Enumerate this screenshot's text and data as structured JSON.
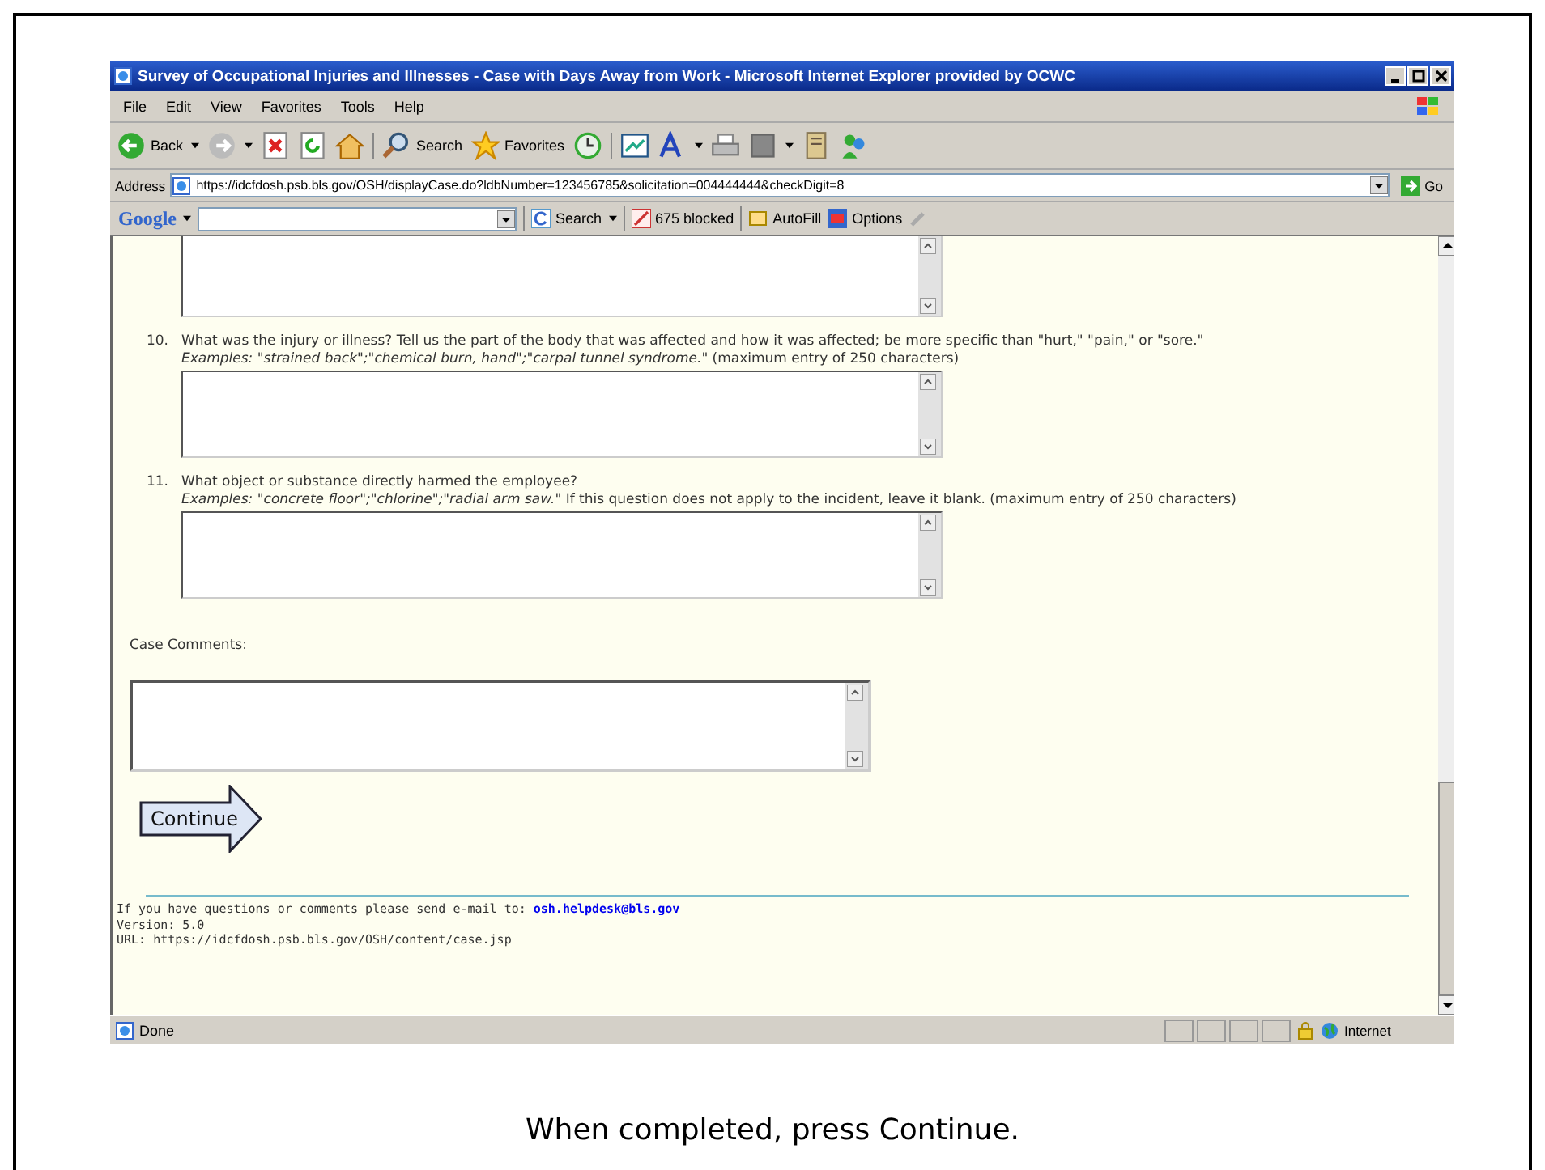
{
  "window": {
    "title": "Survey of Occupational Injuries and Illnesses - Case with Days Away from Work - Microsoft Internet Explorer provided by OCWC"
  },
  "menu": [
    "File",
    "Edit",
    "View",
    "Favorites",
    "Tools",
    "Help"
  ],
  "toolbar": {
    "back": "Back",
    "search": "Search",
    "favorites": "Favorites"
  },
  "address": {
    "label": "Address",
    "value": "https://idcfdosh.psb.bls.gov/OSH/displayCase.do?ldbNumber=123456785&solicitation=004444444&checkDigit=8",
    "go": "Go"
  },
  "google_bar": {
    "logo": "Google",
    "search": "Search",
    "blocked": "675 blocked",
    "autofill": "AutoFill",
    "options": "Options"
  },
  "questions": [
    {
      "number": "10.",
      "text": "What was the injury or illness? Tell us the part of the body that was affected and how it was affected; be more specific than \"hurt,\" \"pain,\" or \"sore.\"",
      "note": "*Examples:  \"strained back\";\"chemical burn, hand\";\"carpal tunnel syndrome.\"* (maximum entry of 250 characters)"
    },
    {
      "number": "11.",
      "text": "What object or substance directly harmed the employee?",
      "note": "*Examples:  \"concrete floor\";\"chlorine\";\"radial arm saw.\"* If this question does not apply to the incident, leave it blank. (maximum entry of 250 characters)"
    }
  ],
  "comments_label": "Case Comments:",
  "continue_button": "Continue",
  "footer": {
    "contact": "If you have questions or comments please send e-mail to:",
    "email": "osh.helpdesk@bls.gov",
    "version": "Version: 5.0",
    "url": "URL: https://idcfdosh.psb.bls.gov/OSH/content/case.jsp"
  },
  "status_bar": {
    "status": "Done",
    "zone": "Internet"
  },
  "caption": "When completed, press Continue."
}
